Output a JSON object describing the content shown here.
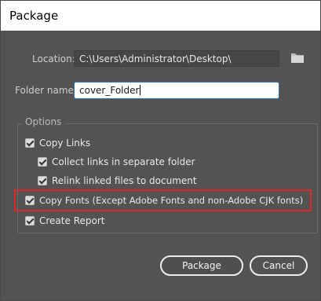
{
  "window": {
    "title": "Package"
  },
  "location": {
    "label": "Location:",
    "value": "C:\\Users\\Administrator\\Desktop\\"
  },
  "folder_name": {
    "label": "Folder name:",
    "value": "cover_Folder"
  },
  "options": {
    "legend": "Options",
    "items": [
      {
        "label": "Copy Links",
        "checked": true
      },
      {
        "label": "Collect links in separate folder",
        "checked": true
      },
      {
        "label": "Relink linked files to document",
        "checked": true
      },
      {
        "label": "Copy Fonts (Except Adobe Fonts and non-Adobe CJK fonts)",
        "checked": true
      },
      {
        "label": "Create Report",
        "checked": true
      }
    ]
  },
  "buttons": {
    "package": "Package",
    "cancel": "Cancel"
  },
  "colors": {
    "highlight": "#e0262a",
    "focus": "#2d7bd6",
    "background": "#535353"
  },
  "icons": {
    "browse": "folder-icon"
  }
}
